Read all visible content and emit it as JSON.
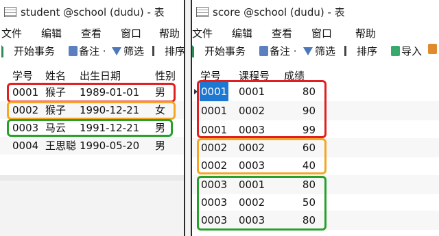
{
  "colors": {
    "red": "#e02020",
    "orange": "#f5a623",
    "green": "#27a12c",
    "selection": "#1e78d2"
  },
  "left": {
    "title": "student @school (dudu) - 表",
    "menu": [
      "文件",
      "编辑",
      "查看",
      "窗口",
      "帮助"
    ],
    "toolbar": {
      "begin": "开始事务",
      "note": "备注 ·",
      "filter": "筛选",
      "sort": "排序"
    },
    "headers": [
      "学号",
      "姓名",
      "出生日期",
      "性别"
    ],
    "rows": [
      [
        "0001",
        "猴子",
        "1989-01-01",
        "男"
      ],
      [
        "0002",
        "猴子",
        "1990-12-21",
        "女"
      ],
      [
        "0003",
        "马云",
        "1991-12-21",
        "男"
      ],
      [
        "0004",
        "王思聪",
        "1990-05-20",
        "男"
      ]
    ]
  },
  "right": {
    "title": "score @school (dudu) - 表",
    "menu": [
      "文件",
      "编辑",
      "查看",
      "窗口",
      "帮助"
    ],
    "toolbar": {
      "begin": "开始事务",
      "note": "备注 ·",
      "filter": "筛选",
      "sort": "排序",
      "import": "导入"
    },
    "headers": [
      "学号",
      "课程号",
      "成绩"
    ],
    "rows": [
      [
        "0001",
        "0001",
        "80"
      ],
      [
        "0001",
        "0002",
        "90"
      ],
      [
        "0001",
        "0003",
        "99"
      ],
      [
        "0002",
        "0002",
        "60"
      ],
      [
        "0002",
        "0003",
        "40"
      ],
      [
        "0003",
        "0001",
        "80"
      ],
      [
        "0003",
        "0002",
        "50"
      ],
      [
        "0003",
        "0003",
        "80"
      ]
    ]
  }
}
